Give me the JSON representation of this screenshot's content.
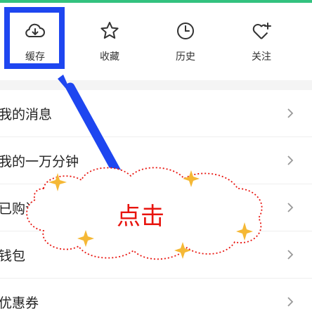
{
  "quick_actions": [
    {
      "label": "缓存",
      "icon": "cloud-download-icon"
    },
    {
      "label": "收藏",
      "icon": "star-icon"
    },
    {
      "label": "历史",
      "icon": "clock-icon"
    },
    {
      "label": "关注",
      "icon": "heart-plus-icon"
    }
  ],
  "menu_items": [
    {
      "label": "我的消息"
    },
    {
      "label": "我的一万分钟"
    },
    {
      "label": "已购课"
    },
    {
      "label": "钱包"
    },
    {
      "label": "优惠券"
    }
  ],
  "annotation": {
    "text": "点击"
  },
  "colors": {
    "accent": "#33c27f",
    "highlight": "#1e46f0",
    "callout_text": "#e8140e",
    "sparkle": "#f5b835"
  }
}
